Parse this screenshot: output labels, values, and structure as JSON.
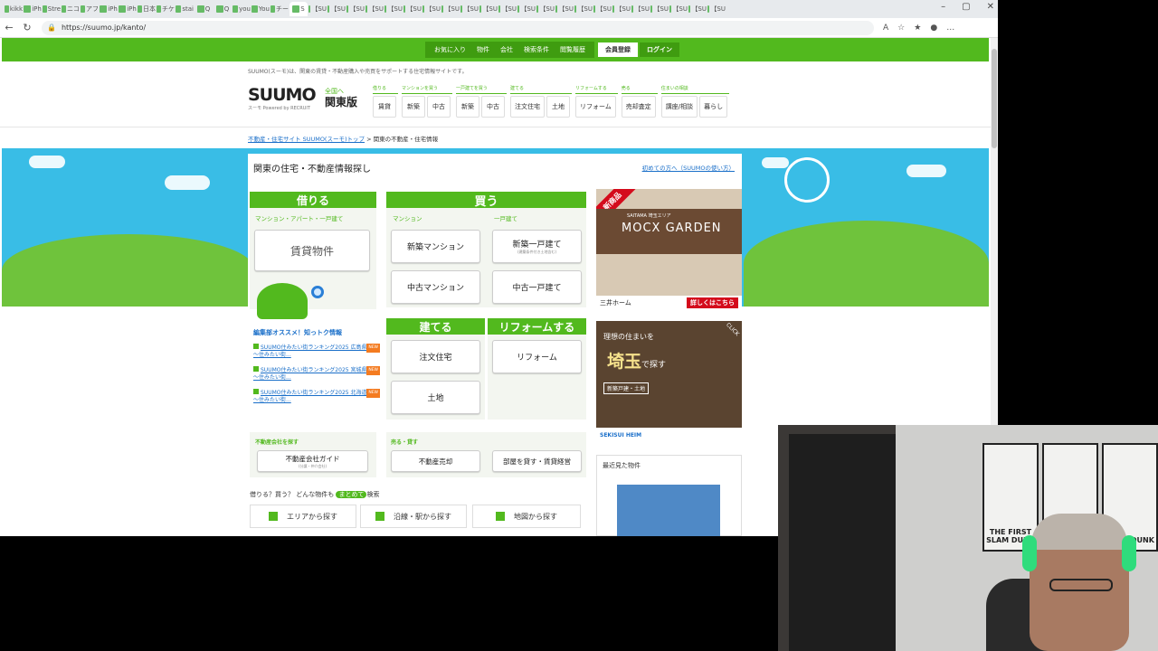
{
  "browser": {
    "tabs": [
      "kikk",
      "iPh",
      "Stre",
      "ニコ",
      "アフ",
      "iPh",
      "iPh",
      "日本",
      "チケ",
      "stai",
      "Q",
      "Q",
      "you",
      "You",
      "チー",
      "S",
      "【SU",
      "【SU",
      "【SU",
      "【SU",
      "【SU",
      "【SU",
      "【SU",
      "【SU",
      "【SU",
      "【SU",
      "【SU",
      "【SU",
      "【SU",
      "【SU",
      "【SU",
      "【SU",
      "【SU",
      "【SU",
      "【SU",
      "【SU",
      "【SU",
      "【SU"
    ],
    "url": "https://suumo.jp/kanto/",
    "window_controls": [
      "–",
      "▢",
      "✕"
    ]
  },
  "global_bar": {
    "nav": [
      "お気に入り",
      "物件",
      "会社",
      "検索条件",
      "閲覧履歴"
    ],
    "register": "会員登録",
    "login": "ログイン"
  },
  "header": {
    "tagline": "SUUMO(スーモ)は、関東の賃貸・不動産購入や売買をサポートする住宅情報サイトです。",
    "logo": "SUUMO",
    "logo_sub": "スーモ  Powered by RECRUIT",
    "region_small": "全国へ",
    "region": "関東版",
    "nav_groups": [
      {
        "label": "借りる",
        "items": [
          "賃貸"
        ]
      },
      {
        "label": "マンションを買う",
        "items": [
          "新築",
          "中古"
        ]
      },
      {
        "label": "一戸建てを買う",
        "items": [
          "新築",
          "中古"
        ]
      },
      {
        "label": "建てる",
        "items": [
          "注文住宅",
          "土地"
        ]
      },
      {
        "label": "リフォームする",
        "items": [
          "リフォーム"
        ]
      },
      {
        "label": "売る",
        "items": [
          "売却査定"
        ]
      },
      {
        "label": "住まいの相談",
        "items": [
          "講座/相談",
          "暮らし"
        ]
      }
    ]
  },
  "breadcrumb": {
    "link": "不動産・住宅サイト SUUMO(スーモ)トップ",
    "sep": ">",
    "current": "関東の不動産・住宅情報"
  },
  "panel": {
    "title": "関東の住宅・不動産情報探し",
    "help_link": "初めての方へ（SUUMOの使い方）",
    "rent": {
      "head": "借りる",
      "sub": "マンション・アパート・一戸建て",
      "button": "賃貸物件"
    },
    "buy": {
      "head": "買う",
      "sub_mansion": "マンション",
      "sub_house": "一戸建て",
      "buttons": [
        "新築マンション",
        "新築一戸建て",
        "中古マンション",
        "中古一戸建て"
      ],
      "new_house_note": "(建築条件付き土地含む)"
    },
    "build": {
      "head": "建てる",
      "buttons": [
        "注文住宅",
        "土地"
      ]
    },
    "reform": {
      "head": "リフォームする",
      "buttons": [
        "リフォーム"
      ]
    },
    "news": {
      "head": "編集部オススメ！知っトク情報",
      "items": [
        {
          "text": "SUUMO住みたい街ランキング2025 広島県版　～住みたい街...",
          "badge": "NEW"
        },
        {
          "text": "SUUMO住みたい街ランキング2025 宮城県版　～住みたい街...",
          "badge": "NEW"
        },
        {
          "text": "SUUMO住みたい街ランキング2025 北海道版　～住みたい街...",
          "badge": "NEW"
        }
      ]
    },
    "company": {
      "label": "不動産会社を探す",
      "button": "不動産会社ガイド",
      "button_note": "(分譲・仲介会社)"
    },
    "sell": {
      "label": "売る・貸す",
      "buttons": [
        "不動産売却",
        "部屋を貸す・賃貸経営"
      ]
    },
    "search": {
      "lead_pre": "借りる？買う？ どんな物件も",
      "lead_hl": "まとめて",
      "lead_post": "検索",
      "buttons": [
        "エリアから探す",
        "沿線・駅から探す",
        "地図から探す"
      ]
    },
    "ad1": {
      "ribbon": "新商品",
      "sub": "SAITAMA 埼玉エリア",
      "title": "MOCX GARDEN",
      "brand": "三井ホーム",
      "cta": "詳しくはこちら"
    },
    "ad2": {
      "line1": "理想の住まいを",
      "line2_big": "埼玉",
      "line2_small": "で探す",
      "line3": "新築戸建・土地",
      "click": "CLICK",
      "brand": "SEKISUI HEIM"
    },
    "recent": {
      "label": "最近見た物件"
    }
  },
  "webcam": {
    "poster_texts": [
      "THE FIRST SLAM DUNK",
      "",
      "SLAM DUNK"
    ]
  },
  "colors": {
    "brand_green": "#52b91e",
    "dark_green": "#3f9c10",
    "sky": "#39bde6",
    "link_blue": "#1a6fc9"
  }
}
